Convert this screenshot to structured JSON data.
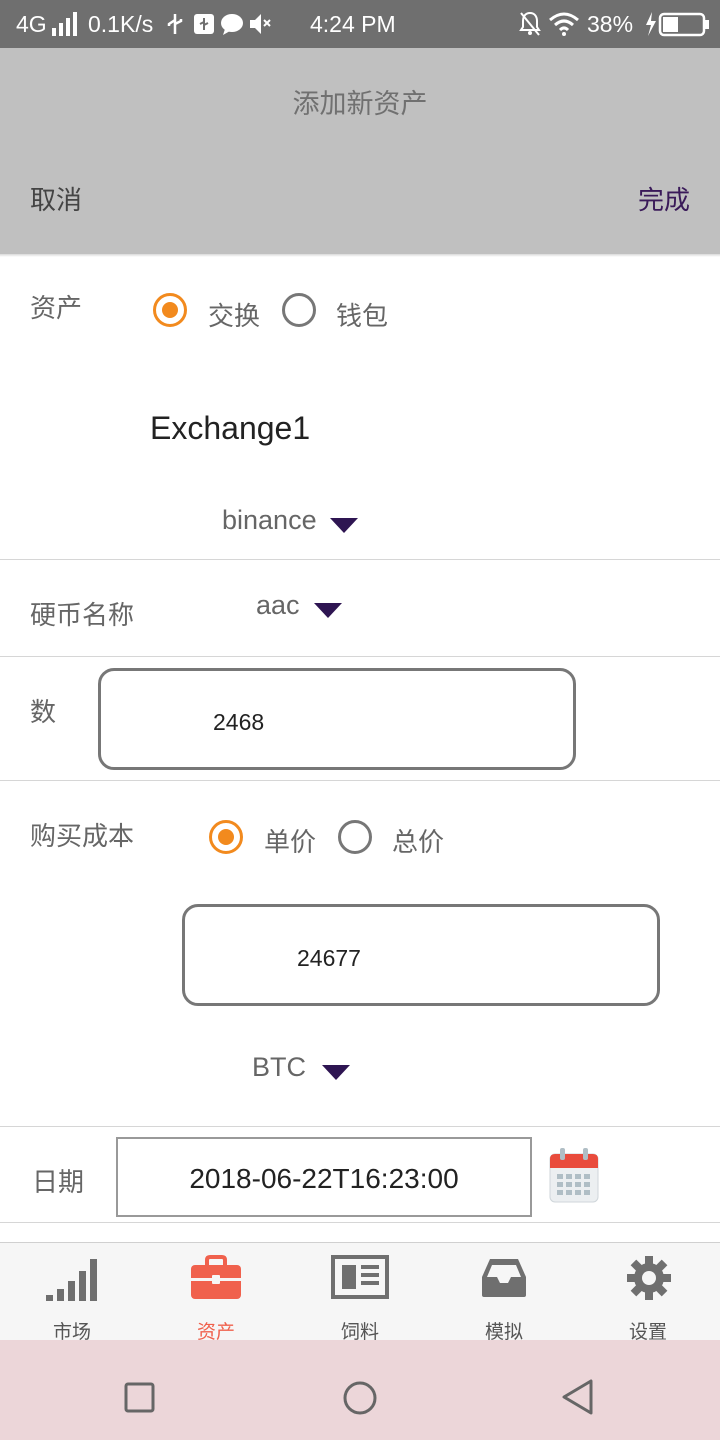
{
  "status_bar": {
    "network": "4G",
    "speed": "0.1K/s",
    "time": "4:24 PM",
    "battery": "38%"
  },
  "header": {
    "title": "添加新资产",
    "cancel": "取消",
    "done": "完成"
  },
  "asset": {
    "label": "资产",
    "options": [
      "交换",
      "钱包"
    ],
    "selected": "交换",
    "exchange_name": "Exchange1",
    "exchange_select": "binance"
  },
  "coin": {
    "label": "硬币名称",
    "value": "aac"
  },
  "quantity": {
    "label": "数",
    "value": "2468"
  },
  "cost": {
    "label": "购买成本",
    "options": [
      "单价",
      "总价"
    ],
    "selected": "单价",
    "value": "24677",
    "currency": "BTC"
  },
  "date": {
    "label": "日期",
    "value": "2018-06-22T16:23:00"
  },
  "tabs": [
    {
      "label": "市场",
      "icon": "signal-bars-icon"
    },
    {
      "label": "资产",
      "icon": "briefcase-icon"
    },
    {
      "label": "饲料",
      "icon": "newspaper-icon"
    },
    {
      "label": "模拟",
      "icon": "inbox-tray-icon"
    },
    {
      "label": "设置",
      "icon": "gear-icon"
    }
  ],
  "active_tab": "资产",
  "colors": {
    "accent": "#f28a1e",
    "done": "#3a1a59",
    "caret": "#2e1552",
    "active_tab": "#f0614d",
    "inactive_tab": "#6f6f6f"
  }
}
